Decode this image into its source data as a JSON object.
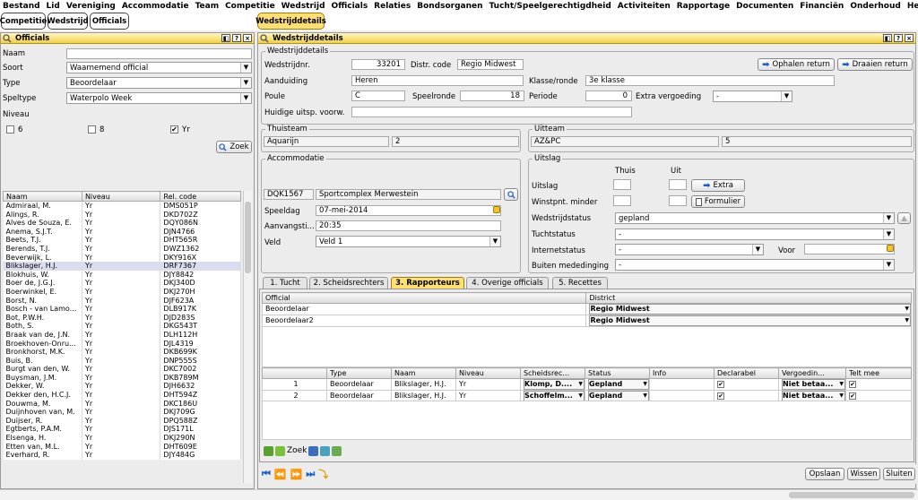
{
  "menu": [
    "Bestand",
    "Lid",
    "Vereniging",
    "Accommodatie",
    "Team",
    "Competitie",
    "Wedstrijd",
    "Officials",
    "Relaties",
    "Bondsorganen",
    "Tucht/Speelgerechtigdheid",
    "Activiteiten",
    "Rapportage",
    "Documenten",
    "Financiën",
    "Onderhoud",
    "Help"
  ],
  "window_tabs": {
    "left": [
      "Competitie",
      "Wedstrijd",
      "Officials"
    ],
    "right": "Wedstrijddetails"
  },
  "officials": {
    "title": "Officials",
    "labels": {
      "naam": "Naam",
      "soort": "Soort",
      "type": "Type",
      "speltype": "Speltype",
      "niveau": "Niveau"
    },
    "values": {
      "naam": "",
      "soort": "Waarnemend official",
      "type": "Beoordelaar",
      "speltype": "Waterpolo Week"
    },
    "niveau_options": [
      {
        "label": "6",
        "checked": false
      },
      {
        "label": "8",
        "checked": false
      },
      {
        "label": "Yr",
        "checked": true
      }
    ],
    "zoek": "Zoek",
    "columns": [
      "Naam",
      "Niveau",
      "Rel. code"
    ],
    "rows": [
      [
        "Admiraal, M.",
        "Yr",
        "DMS051P"
      ],
      [
        "Alings, R.",
        "Yr",
        "DKD702Z"
      ],
      [
        "Alves de Souza, E.",
        "Yr",
        "DQY086N"
      ],
      [
        "Anema, S.J.T.",
        "Yr",
        "DJN4766"
      ],
      [
        "Beets, T.J.",
        "Yr",
        "DHT565R"
      ],
      [
        "Berends, T.J.",
        "Yr",
        "DWZ1362"
      ],
      [
        "Beverwijk, L.",
        "Yr",
        "DKY916X"
      ],
      [
        "Blikslager, H.J.",
        "Yr",
        "DRF7367"
      ],
      [
        "Blokhuis, W.",
        "Yr",
        "DJY8842"
      ],
      [
        "Boer de, J.G.J.",
        "Yr",
        "DKJ340D"
      ],
      [
        "Boerwinkel, E.",
        "Yr",
        "DKJ270H"
      ],
      [
        "Borst, N.",
        "Yr",
        "DJF623A"
      ],
      [
        "Bosch - van Lamo...",
        "Yr",
        "DLB917K"
      ],
      [
        "Bot, P.W.H.",
        "Yr",
        "DJD283S"
      ],
      [
        "Both, S.",
        "Yr",
        "DKG543T"
      ],
      [
        "Braak van de, J.N.",
        "Yr",
        "DLH112H"
      ],
      [
        "Broekhoven-Onru...",
        "Yr",
        "DJL4319"
      ],
      [
        "Bronkhorst, M.K.",
        "Yr",
        "DKB699K"
      ],
      [
        "Buis, B.",
        "Yr",
        "DNP555S"
      ],
      [
        "Burgt van den, W.",
        "Yr",
        "DKC7002"
      ],
      [
        "Buysman, J.M.",
        "Yr",
        "DKB789M"
      ],
      [
        "Dekker, W.",
        "Yr",
        "DJH6632"
      ],
      [
        "Dekker den, H.C.J.",
        "Yr",
        "DHT594Z"
      ],
      [
        "Douwma, M.",
        "Yr",
        "DKC186U"
      ],
      [
        "Duijnhoven van, M.",
        "Yr",
        "DKJ709G"
      ],
      [
        "Duijser, R.",
        "Yr",
        "DPQ588Z"
      ],
      [
        "Egtberts, P.A.M.",
        "Yr",
        "DJS171L"
      ],
      [
        "Elsenga, H.",
        "Yr",
        "DKJ290N"
      ],
      [
        "Etten van, M.L.",
        "Yr",
        "DHT609E"
      ],
      [
        "Everhard, R.",
        "Yr",
        "DJY484G"
      ]
    ],
    "selected_row": 7
  },
  "details": {
    "title": "Wedstrijddetails",
    "group_title": "Wedstrijddetails",
    "labels": {
      "nr": "Wedstrijdnr.",
      "district": "Distr. code",
      "aanduiding": "Aanduiding",
      "klasse": "Klasse/ronde",
      "poule": "Poule",
      "speelronde": "Speelronde",
      "periode": "Periode",
      "extra": "Extra vergoeding",
      "huidige": "Huidige uitsp. voorw."
    },
    "values": {
      "nr": "33201",
      "district": "Regio Midwest",
      "aanduiding": "Heren",
      "klasse": "3e klasse",
      "poule": "C",
      "speelronde": "18",
      "periode": "0",
      "extra": "-",
      "huidige": ""
    },
    "buttons": {
      "ophalen": "Ophalen return",
      "draaien": "Draaien return"
    },
    "thuisteam": {
      "title": "Thuisteam",
      "name": "Aquarijn",
      "nr": "2"
    },
    "uitteam": {
      "title": "Uitteam",
      "name": "AZ&PC",
      "nr": "5"
    },
    "accommodatie": {
      "title": "Accommodatie",
      "code": "DQK1567",
      "name": "Sportcomplex Merwestein",
      "speeldag_label": "Speeldag",
      "speeldag": "07-mei-2014",
      "aanvang_label": "Aanvangsti...",
      "aanvang": "20:35",
      "veld_label": "Veld",
      "veld": "Veld 1"
    },
    "uitslag": {
      "title": "Uitslag",
      "thuis": "Thuis",
      "uit": "Uit",
      "uitslag_label": "Uitslag",
      "winstpnt_label": "Winstpnt. minder",
      "extra_btn": "Extra",
      "formulier_btn": "Formulier",
      "status_label": "Wedstrijdstatus",
      "status": "gepland",
      "tucht_label": "Tuchtstatus",
      "tucht": "-",
      "internet_label": "Internetstatus",
      "internet": "-",
      "voor_label": "Voor",
      "voor": "",
      "buiten_label": "Buiten mededinging",
      "buiten": "-"
    },
    "subtabs": [
      "1. Tucht",
      "2. Scheidsrechters",
      "3. Rapporteurs",
      "4. Overige officials",
      "5. Recettes"
    ],
    "active_subtab": 2,
    "district_table": {
      "columns": [
        "Official",
        "District"
      ],
      "rows": [
        [
          "Beoordelaar",
          "Regio Midwest"
        ],
        [
          "Beoordelaar2",
          "Regio Midwest"
        ]
      ]
    },
    "assign_table": {
      "columns": [
        "",
        "Type",
        "Naam",
        "Niveau",
        "Scheidsrec...",
        "Status",
        "Info",
        "Declarabel",
        "Vergoedin...",
        "Telt mee"
      ],
      "rows": [
        [
          "1",
          "Beoordelaar",
          "Blikslager, H.J.",
          "Yr",
          "Klomp, D....",
          "Gepland",
          "",
          "✔",
          "Niet betaa...",
          "✔"
        ],
        [
          "2",
          "Beoordelaar",
          "Blikslager, H.J.",
          "Yr",
          "Schoffelm...",
          "Gepland",
          "",
          "✔",
          "Niet betaa...",
          "✔"
        ]
      ]
    },
    "zoek": "Zoek",
    "footer_buttons": [
      "Opslaan",
      "Wissen",
      "Sluiten"
    ]
  },
  "colors": {
    "title_yellow": "#f4d03f",
    "accent_blue": "#1a5fc8",
    "tab_active": "#fde071"
  }
}
